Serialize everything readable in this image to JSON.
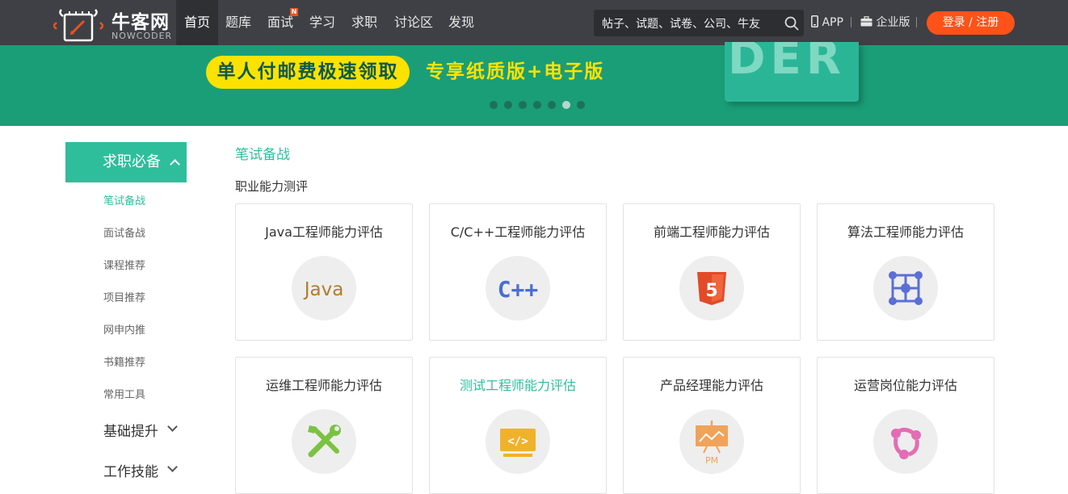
{
  "brand": {
    "name": "牛客网",
    "sub": "NOWCODER"
  },
  "nav": {
    "items": [
      "首页",
      "题库",
      "面试",
      "学习",
      "求职",
      "讨论区",
      "发现"
    ],
    "badge": "N"
  },
  "search": {
    "placeholder": "帖子、试题、试卷、公司、牛友"
  },
  "top_links": {
    "app": "APP",
    "enterprise": "企业版"
  },
  "login": {
    "label": "登录 / 注册"
  },
  "banner": {
    "pill_text": "单人付邮费极速领取",
    "promo_text": "专享纸质版+电子版",
    "book_letters": "DER",
    "slide_count": 7,
    "active_slide": 6
  },
  "sidebar": {
    "head": "求职必备",
    "sub_items": [
      "笔试备战",
      "面试备战",
      "课程推荐",
      "项目推荐",
      "网申内推",
      "书籍推荐",
      "常用工具"
    ],
    "active_sub": 0,
    "groups": [
      "基础提升",
      "工作技能"
    ]
  },
  "main": {
    "section_title": "笔试备战",
    "subsection_title": "职业能力测评",
    "cards": [
      {
        "title": "Java工程师能力评估",
        "icon": "java-icon",
        "icon_text": "Java"
      },
      {
        "title": "C/C++工程师能力评估",
        "icon": "cpp-icon",
        "icon_text": "C++"
      },
      {
        "title": "前端工程师能力评估",
        "icon": "html5-icon",
        "icon_text": "5"
      },
      {
        "title": "算法工程师能力评估",
        "icon": "algorithm-icon",
        "icon_text": ""
      },
      {
        "title": "运维工程师能力评估",
        "icon": "tools-icon",
        "icon_text": ""
      },
      {
        "title": "测试工程师能力评估",
        "icon": "code-icon",
        "icon_text": "</>"
      },
      {
        "title": "产品经理能力评估",
        "icon": "pm-icon",
        "icon_text": "PM"
      },
      {
        "title": "运营岗位能力评估",
        "icon": "share-icon",
        "icon_text": ""
      }
    ],
    "highlighted_card": 5
  },
  "colors": {
    "accent": "#2fbe9b",
    "nav_bg": "#3f4045",
    "banner_bg": "#1a9e78",
    "login": "#ff5219",
    "pill": "#fce200"
  }
}
